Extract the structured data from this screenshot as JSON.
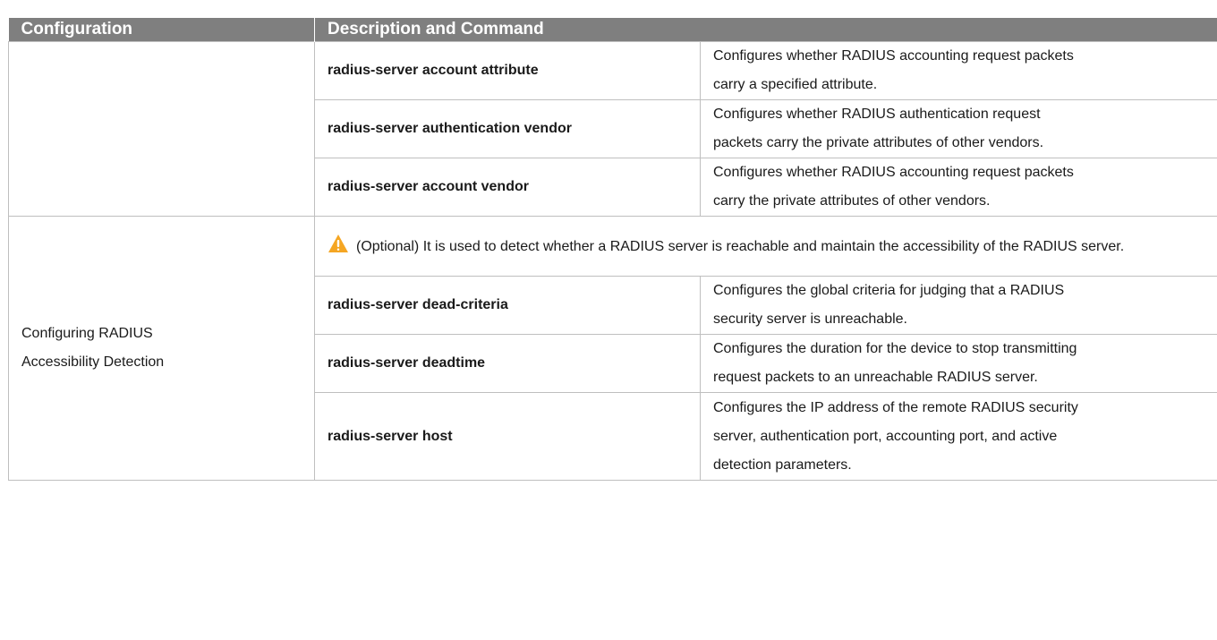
{
  "header": {
    "col_configuration": "Configuration",
    "col_description": "Description and Command"
  },
  "rows": [
    {
      "command": "radius-server account attribute",
      "description_lines": [
        "Configures whether RADIUS accounting request packets",
        "carry a specified attribute."
      ]
    },
    {
      "command": "radius-server authentication vendor",
      "description_lines": [
        "Configures whether RADIUS authentication request",
        "packets carry the private attributes of other vendors."
      ]
    },
    {
      "command": "radius-server account vendor",
      "description_lines": [
        "Configures whether RADIUS accounting request packets",
        "carry the private attributes of other vendors."
      ]
    }
  ],
  "section2": {
    "configuration_lines": [
      "Configuring RADIUS",
      "Accessibility Detection"
    ],
    "note": "(Optional) It is used to detect whether a RADIUS server is reachable and maintain the accessibility of the RADIUS server.",
    "note_icon": "warning-icon",
    "rows": [
      {
        "command": "radius-server dead-criteria",
        "description_lines": [
          "Configures the global criteria for judging that a RADIUS",
          "security server is unreachable."
        ]
      },
      {
        "command": "radius-server deadtime",
        "description_lines": [
          "Configures the duration for the device to stop transmitting",
          "request packets to an unreachable RADIUS server."
        ]
      },
      {
        "command": "radius-server host",
        "description_lines": [
          "Configures the IP address of the remote RADIUS security",
          "server, authentication port, accounting port, and active",
          "detection parameters."
        ]
      }
    ]
  },
  "colors": {
    "header_bg": "#7f7f7f",
    "header_text": "#ffffff",
    "border": "#bfbfbf",
    "warning": "#f5a623"
  }
}
